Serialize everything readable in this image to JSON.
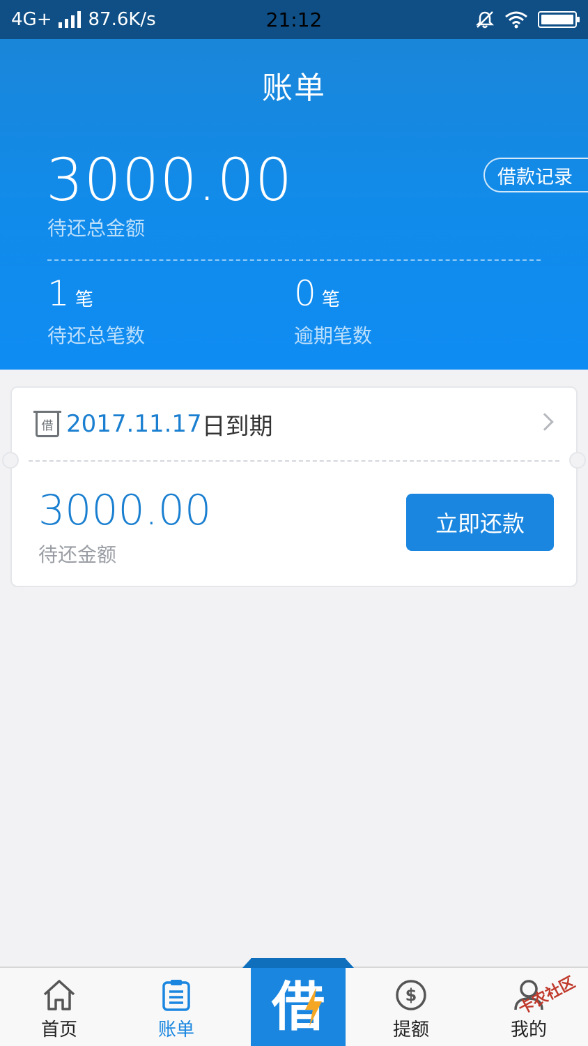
{
  "status_bar": {
    "network": "4G+",
    "speed": "87.6K/s",
    "time": "21:12"
  },
  "header": {
    "title": "账单",
    "total_amount": "3000.00",
    "total_label": "待还总金额",
    "record_button": "借款记录",
    "pending_count": "1",
    "pending_unit": "笔",
    "pending_label": "待还总笔数",
    "overdue_count": "0",
    "overdue_unit": "笔",
    "overdue_label": "逾期笔数"
  },
  "bill_card": {
    "icon_text": "借",
    "due_date": "2017.11.17",
    "due_suffix": "日到期",
    "amount": "3000.00",
    "amount_label": "待还金额",
    "repay_button": "立即还款"
  },
  "tabbar": {
    "home": "首页",
    "bill": "账单",
    "center": "借",
    "credit": "提额",
    "mine": "我的"
  },
  "watermark": "卡农社区",
  "colors": {
    "accent": "#1a86df",
    "status_bar": "#0f4f86",
    "background": "#f2f2f4"
  }
}
